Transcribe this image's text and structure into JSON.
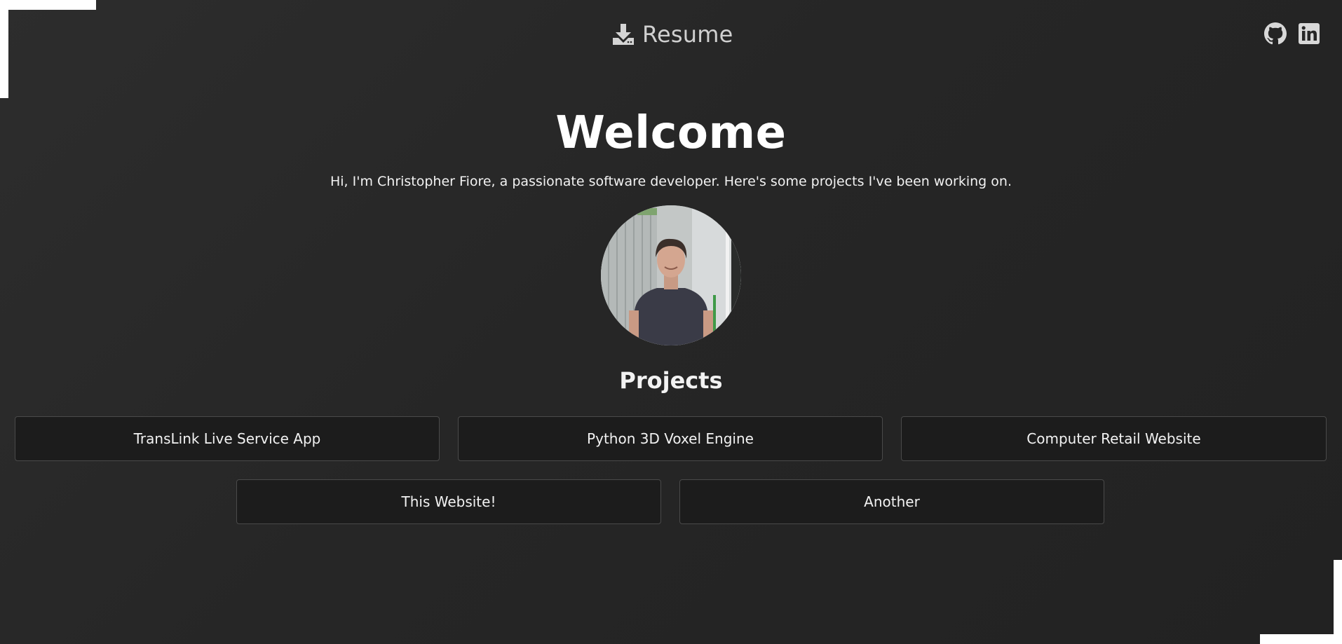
{
  "header": {
    "resume_label": "Resume",
    "resume_icon": "download-icon",
    "social": [
      {
        "name": "github-icon"
      },
      {
        "name": "linkedin-icon"
      }
    ]
  },
  "hero": {
    "title": "Welcome",
    "intro": "Hi, I'm Christopher Fiore, a passionate software developer. Here's some projects I've been working on."
  },
  "projects": {
    "title": "Projects",
    "items": [
      {
        "label": "TransLink Live Service App"
      },
      {
        "label": "Python 3D Voxel Engine"
      },
      {
        "label": "Computer Retail Website"
      },
      {
        "label": "This Website!"
      },
      {
        "label": "Another"
      }
    ]
  },
  "colors": {
    "background": "#262626",
    "card_background": "#1c1c1c",
    "card_border": "#4a4a4a",
    "text": "#ffffff"
  }
}
